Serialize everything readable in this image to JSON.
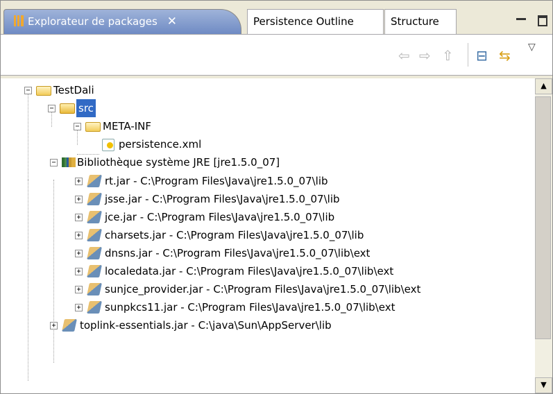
{
  "tabs": [
    {
      "label": "Explorateur de packages",
      "active": true,
      "icon": "package-explorer-icon"
    },
    {
      "label": "Persistence Outline",
      "active": false
    },
    {
      "label": "Structure",
      "active": false
    }
  ],
  "tab_close_glyph": "✕",
  "toolbar": {
    "back_glyph": "⇦",
    "forward_glyph": "⇨",
    "up_glyph": "⇧",
    "collapse_glyph": "⊟",
    "link_glyph": "⇆",
    "menu_glyph": "▽"
  },
  "tree": {
    "project": "TestDali",
    "src": "src",
    "meta_inf": "META-INF",
    "persistence": "persistence.xml",
    "jre_lib": "Bibliothèque système JRE [jre1.5.0_07]",
    "jars": [
      "rt.jar - C:\\Program Files\\Java\\jre1.5.0_07\\lib",
      "jsse.jar - C:\\Program Files\\Java\\jre1.5.0_07\\lib",
      "jce.jar - C:\\Program Files\\Java\\jre1.5.0_07\\lib",
      "charsets.jar - C:\\Program Files\\Java\\jre1.5.0_07\\lib",
      "dnsns.jar - C:\\Program Files\\Java\\jre1.5.0_07\\lib\\ext",
      "localedata.jar - C:\\Program Files\\Java\\jre1.5.0_07\\lib\\ext",
      "sunjce_provider.jar - C:\\Program Files\\Java\\jre1.5.0_07\\lib\\ext",
      "sunpkcs11.jar - C:\\Program Files\\Java\\jre1.5.0_07\\lib\\ext"
    ],
    "toplink": "toplink-essentials.jar - C:\\java\\Sun\\AppServer\\lib"
  },
  "colors": {
    "selection": "#316ac5",
    "active_tab": "#7f98cc"
  }
}
